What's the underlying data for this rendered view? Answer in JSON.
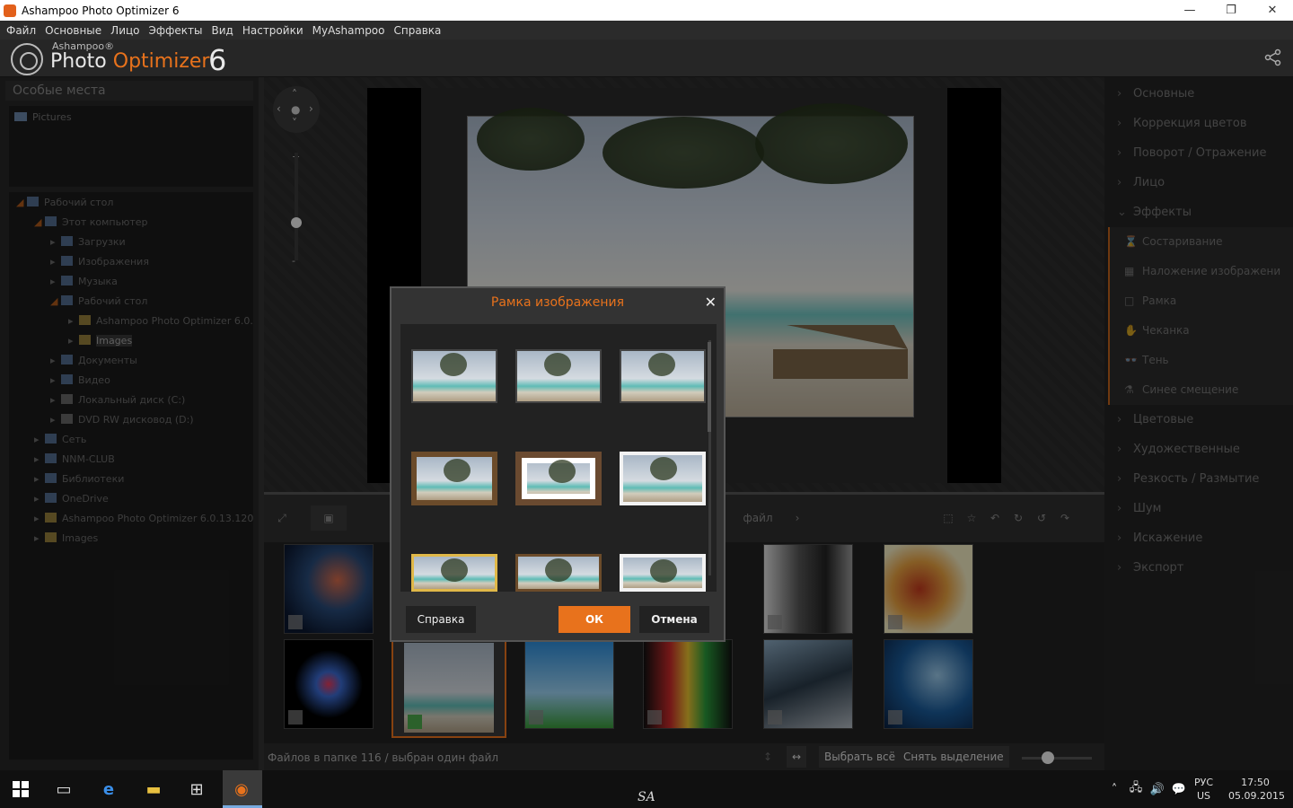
{
  "window": {
    "title": "Ashampoo Photo Optimizer 6",
    "minimize": "—",
    "restore": "❐",
    "close": "✕"
  },
  "menu": [
    "Файл",
    "Основные",
    "Лицо",
    "Эффекты",
    "Вид",
    "Настройки",
    "MyAshampoo",
    "Справка"
  ],
  "brand": {
    "small": "Ashampoo®",
    "word1": "Photo",
    "word2": "Optimizer",
    "version": "6"
  },
  "left_panel": {
    "header": "Особые места",
    "places": [
      "Pictures"
    ],
    "tree": [
      {
        "label": "Рабочий стол",
        "level": 0,
        "open": true
      },
      {
        "label": "Этот компьютер",
        "level": 1,
        "open": true
      },
      {
        "label": "Загрузки",
        "level": 2
      },
      {
        "label": "Изображения",
        "level": 2
      },
      {
        "label": "Музыка",
        "level": 2
      },
      {
        "label": "Рабочий стол",
        "level": 2,
        "open": true
      },
      {
        "label": "Ashampoo Photo Optimizer 6.0.",
        "level": 3
      },
      {
        "label": "Images",
        "level": 3,
        "selected": true
      },
      {
        "label": "Документы",
        "level": 2
      },
      {
        "label": "Видео",
        "level": 2
      },
      {
        "label": "Локальный диск (C:)",
        "level": 2
      },
      {
        "label": "DVD RW дисковод (D:)",
        "level": 2
      },
      {
        "label": "Сеть",
        "level": 1
      },
      {
        "label": "NNM-CLUB",
        "level": 1
      },
      {
        "label": "Библиотеки",
        "level": 1
      },
      {
        "label": "OneDrive",
        "level": 1
      },
      {
        "label": "Ashampoo Photo Optimizer 6.0.13.120",
        "level": 1
      },
      {
        "label": "Images",
        "level": 1
      }
    ]
  },
  "viewer": {
    "zoom_plus": "+",
    "zoom_minus": "-"
  },
  "toolbar": {
    "file_label": "файл"
  },
  "right_panel": {
    "items_top": [
      "Основные",
      "Коррекция цветов",
      "Поворот / Отражение",
      "Лицо",
      "Эффекты"
    ],
    "effects_sub": [
      {
        "icon": "⌛",
        "label": "Состаривание"
      },
      {
        "icon": "▦",
        "label": "Наложение изображени"
      },
      {
        "icon": "□",
        "label": "Рамка"
      },
      {
        "icon": "✋",
        "label": "Чеканка"
      },
      {
        "icon": "👓",
        "label": "Тень"
      },
      {
        "icon": "⚗",
        "label": "Синее смещение"
      }
    ],
    "items_bottom": [
      "Цветовые",
      "Художественные",
      "Резкость / Размытие",
      "Шум",
      "Искажение",
      "Экспорт"
    ]
  },
  "status": {
    "text": "Файлов в папке 116 / выбран один файл",
    "select_all": "Выбрать всё",
    "deselect": "Снять выделение"
  },
  "dialog": {
    "title": "Рамка изображения",
    "help": "Справка",
    "ok": "ОК",
    "cancel": "Отмена"
  },
  "taskbar": {
    "sa": "SA",
    "lang1": "РУС",
    "lang2": "US",
    "time": "17:50",
    "date": "05.09.2015"
  },
  "colors": {
    "accent": "#e8721c",
    "dark": "#262626"
  }
}
